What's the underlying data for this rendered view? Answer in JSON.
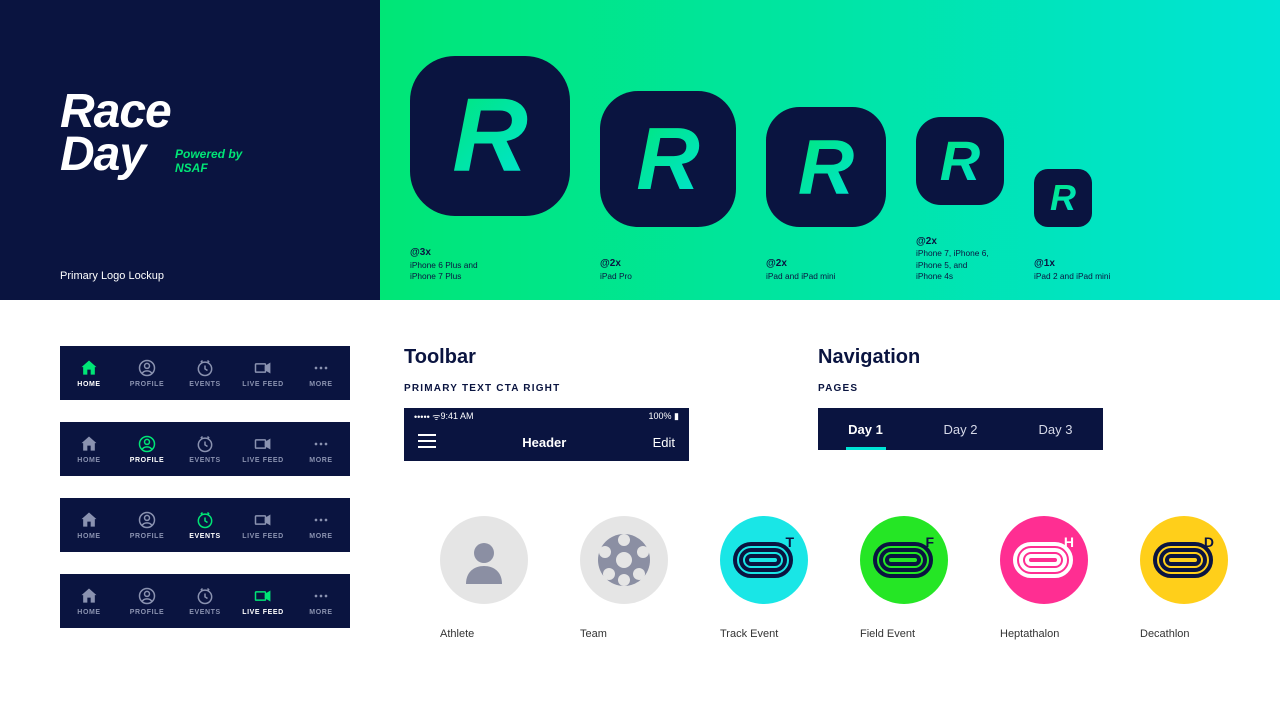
{
  "hero": {
    "logo_line1": "Race",
    "logo_line2": "Day",
    "powered": "Powered by\nNSAF",
    "caption": "Primary Logo Lockup"
  },
  "appicons": [
    {
      "scale": "@3x",
      "device": "iPhone 6 Plus and\niPhone 7 Plus"
    },
    {
      "scale": "@2x",
      "device": "iPad Pro"
    },
    {
      "scale": "@2x",
      "device": "iPad and iPad mini"
    },
    {
      "scale": "@2x",
      "device": "iPhone 7, iPhone 6,\niPhone 5, and\niPhone 4s"
    },
    {
      "scale": "@1x",
      "device": "iPad 2 and iPad mini"
    }
  ],
  "tabs": [
    "HOME",
    "PROFILE",
    "EVENTS",
    "LIVE FEED",
    "MORE"
  ],
  "toolbar": {
    "heading": "Toolbar",
    "sub": "PRIMARY TEXT CTA RIGHT",
    "time": "9:41 AM",
    "battery": "100%",
    "header": "Header",
    "edit": "Edit"
  },
  "nav": {
    "heading": "Navigation",
    "sub": "PAGES",
    "days": [
      "Day 1",
      "Day 2",
      "Day 3"
    ]
  },
  "badges": [
    {
      "label": "Athlete"
    },
    {
      "label": "Team"
    },
    {
      "label": "Track Event",
      "color": "#19e6e6",
      "letter": "T",
      "lcolor": "dark"
    },
    {
      "label": "Field Event",
      "color": "#25e625",
      "letter": "F",
      "lcolor": "dark"
    },
    {
      "label": "Heptathalon",
      "color": "#ff2e92",
      "letter": "H",
      "lcolor": "white"
    },
    {
      "label": "Decathlon",
      "color": "#ffcf1a",
      "letter": "D",
      "lcolor": "dark"
    }
  ]
}
